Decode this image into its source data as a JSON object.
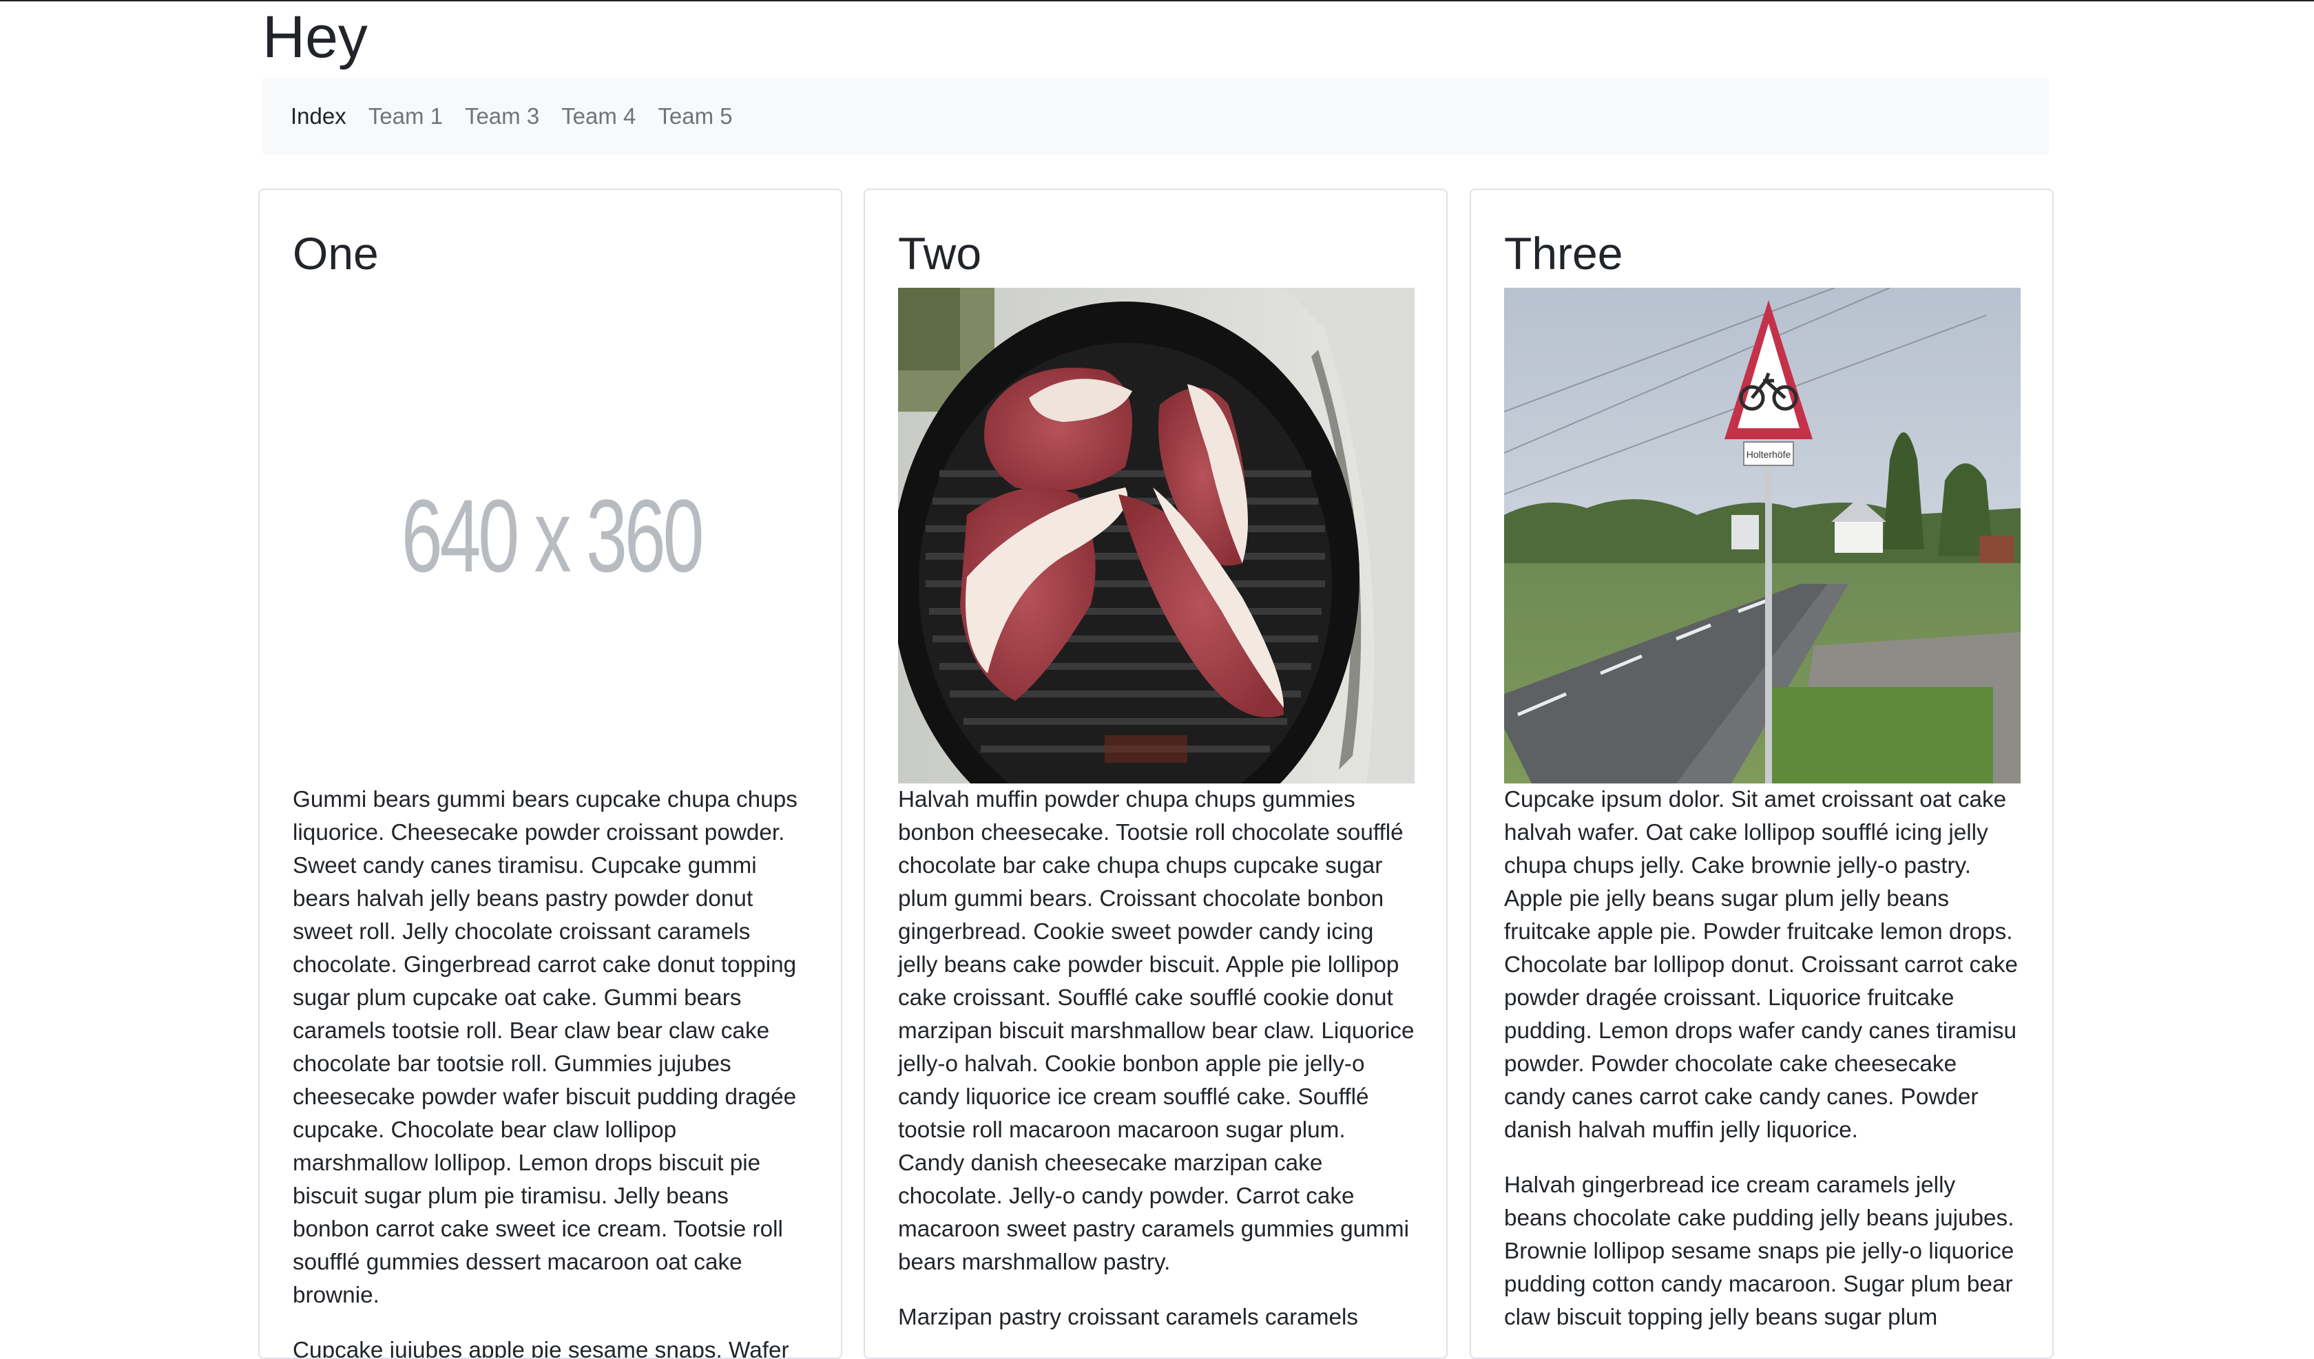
{
  "site": {
    "title": "Hey"
  },
  "nav": {
    "items": [
      {
        "label": "Index",
        "active": true
      },
      {
        "label": "Team 1",
        "active": false
      },
      {
        "label": "Team 3",
        "active": false
      },
      {
        "label": "Team 4",
        "active": false
      },
      {
        "label": "Team 5",
        "active": false
      }
    ]
  },
  "cards": [
    {
      "title": "One",
      "image": {
        "kind": "placeholder",
        "label": "640 x 360"
      },
      "paragraphs": [
        "Gummi bears gummi bears cupcake chupa chups liquorice. Cheesecake powder croissant powder. Sweet candy canes tiramisu. Cupcake gummi bears halvah jelly beans pastry powder donut sweet roll. Jelly chocolate croissant caramels chocolate. Gingerbread carrot cake donut topping sugar plum cupcake oat cake. Gummi bears caramels tootsie roll. Bear claw bear claw cake chocolate bar tootsie roll. Gummies jujubes cheesecake powder wafer biscuit pudding dragée cupcake. Chocolate bear claw lollipop marshmallow lollipop. Lemon drops biscuit pie biscuit sugar plum pie tiramisu. Jelly beans bonbon carrot cake sweet ice cream. Tootsie roll soufflé gummies dessert macaroon oat cake brownie.",
        "Cupcake jujubes apple pie sesame snaps. Wafer"
      ]
    },
    {
      "title": "Two",
      "image": {
        "kind": "photo",
        "icon": "grill-meat-photo"
      },
      "paragraphs": [
        "Halvah muffin powder chupa chups gummies bonbon cheesecake. Tootsie roll chocolate soufflé chocolate bar cake chupa chups cupcake sugar plum gummi bears. Croissant chocolate bonbon gingerbread. Cookie sweet powder candy icing jelly beans cake powder biscuit. Apple pie lollipop cake croissant. Soufflé cake soufflé cookie donut marzipan biscuit marshmallow bear claw. Liquorice jelly-o halvah. Cookie bonbon apple pie jelly-o candy liquorice ice cream soufflé cake. Soufflé tootsie roll macaroon macaroon sugar plum. Candy danish cheesecake marzipan cake chocolate. Jelly-o candy powder. Carrot cake macaroon sweet pastry caramels gummies gummi bears marshmallow pastry.",
        "Marzipan pastry croissant caramels caramels"
      ]
    },
    {
      "title": "Three",
      "image": {
        "kind": "photo",
        "icon": "road-sign-photo",
        "sign_text": "Holterhöfe"
      },
      "paragraphs": [
        "Cupcake ipsum dolor. Sit amet croissant oat cake halvah wafer. Oat cake lollipop soufflé icing jelly chupa chups jelly. Cake brownie jelly-o pastry. Apple pie jelly beans sugar plum jelly beans fruitcake apple pie. Powder fruitcake lemon drops. Chocolate bar lollipop donut. Croissant carrot cake powder dragée croissant. Liquorice fruitcake pudding. Lemon drops wafer candy canes tiramisu powder. Powder chocolate cake cheesecake candy canes carrot cake candy canes. Powder danish halvah muffin jelly liquorice.",
        "Halvah gingerbread ice cream caramels jelly beans chocolate cake pudding jelly beans jujubes. Brownie lollipop sesame snaps pie jelly-o liquorice pudding cotton candy macaroon. Sugar plum bear claw biscuit topping jelly beans sugar plum"
      ]
    }
  ]
}
